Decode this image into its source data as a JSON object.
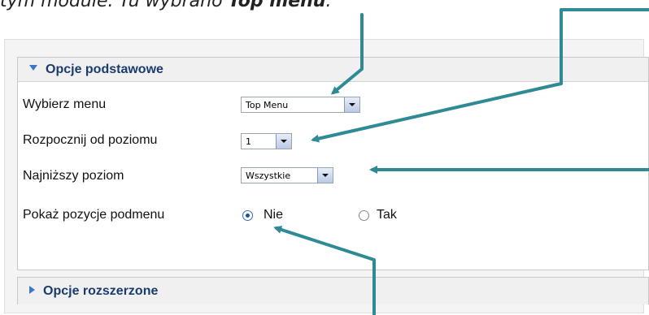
{
  "caption": {
    "text": "tym module. Tu wybrano ",
    "bold": "Top menu",
    "end": "."
  },
  "basic_panel": {
    "title": "Opcje podstawowe"
  },
  "advanced_panel": {
    "title": "Opcje rozszerzone"
  },
  "fields": {
    "menu": {
      "label": "Wybierz menu",
      "value": "Top Menu"
    },
    "start_level": {
      "label": "Rozpocznij od poziomu",
      "value": "1"
    },
    "end_level": {
      "label": "Najniższy poziom",
      "value": "Wszystkie"
    },
    "show_submenu": {
      "label": "Pokaż pozycje podmenu",
      "options": [
        "Nie",
        "Tak"
      ],
      "selected": "Nie"
    }
  },
  "colors": {
    "arrow": "#2e8a94",
    "panel_title": "#1a3b6e",
    "triangle": "#3b78c3"
  }
}
